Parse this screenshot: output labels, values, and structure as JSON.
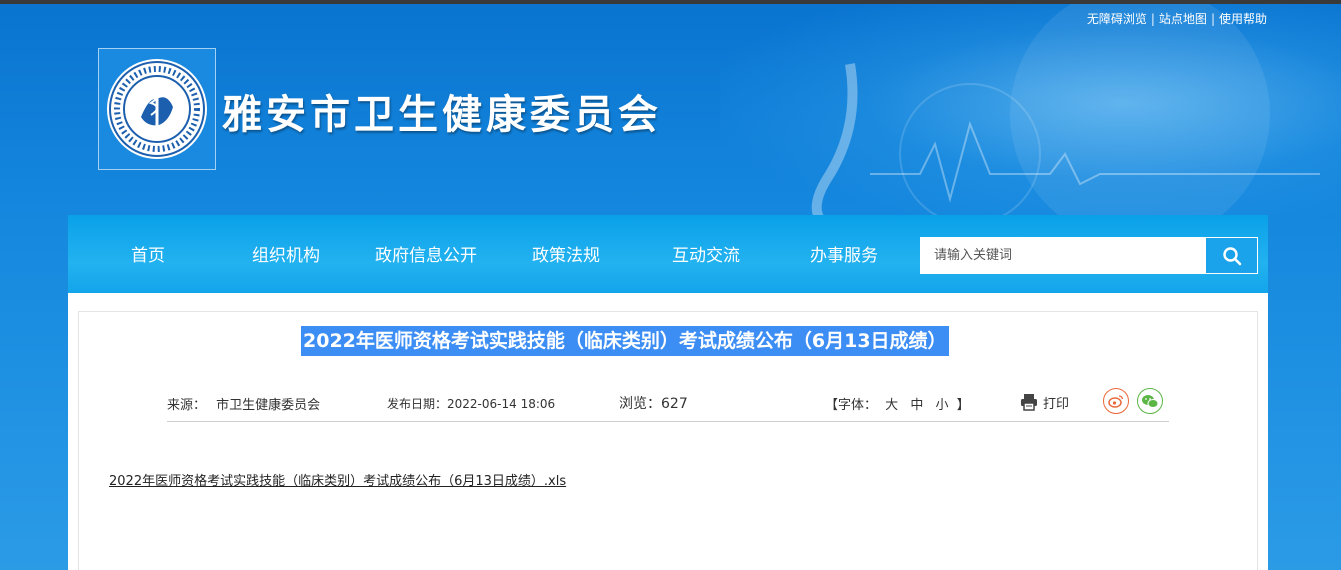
{
  "top_links": [
    "无障碍浏览",
    "站点地图",
    "使用帮助"
  ],
  "site": {
    "title": "雅安市卫生健康委员会",
    "logo_icon": "health-commission-emblem-icon"
  },
  "nav": {
    "items": [
      "首页",
      "组织机构",
      "政府信息公开",
      "政策法规",
      "互动交流",
      "办事服务"
    ],
    "search_placeholder": "请输入关键词",
    "search_icon": "search-icon"
  },
  "article": {
    "title": "2022年医师资格考试实践技能（临床类别）考试成绩公布（6月13日成绩）",
    "source_label": "来源：",
    "source_value": "市卫生健康委员会",
    "date_label": "发布日期：",
    "date_value": "2022-06-14 18:06",
    "views_label": "浏览：",
    "views_value": "627",
    "font_label_open": "【字体：",
    "font_large": "大",
    "font_medium": "中",
    "font_small": "小",
    "font_label_close": "】",
    "print_label": "打印",
    "attachment": "2022年医师资格考试实践技能（临床类别）考试成绩公布（6月13日成绩）.xls"
  },
  "colors": {
    "header_blue": "#1689df",
    "nav_blue": "#22b2f0",
    "title_highlight": "#3d8ef4",
    "weibo": "#e86a3a",
    "wechat": "#5bb646"
  }
}
